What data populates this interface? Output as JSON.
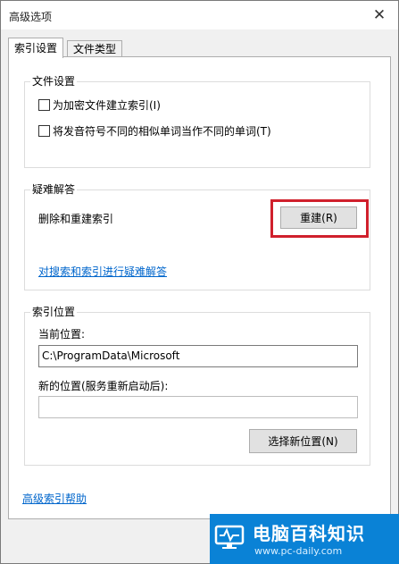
{
  "window": {
    "title": "高级选项",
    "close_glyph": "✕"
  },
  "tabs": [
    {
      "label": "索引设置",
      "active": true
    },
    {
      "label": "文件类型",
      "active": false
    }
  ],
  "file_settings": {
    "label": "文件设置",
    "options": [
      {
        "label": "为加密文件建立索引(I)",
        "checked": false
      },
      {
        "label": "将发音符号不同的相似单词当作不同的单词(T)",
        "checked": false
      }
    ]
  },
  "troubleshooting": {
    "label": "疑难解答",
    "rebuild_text": "删除和重建索引",
    "rebuild_button": "重建(R)",
    "troubleshoot_link": "对搜索和索引进行疑难解答",
    "highlight_color": "#d0202c"
  },
  "index_location": {
    "label": "索引位置",
    "current_label": "当前位置:",
    "current_value": "C:\\ProgramData\\Microsoft",
    "new_label": "新的位置(服务重新启动后):",
    "new_value": "",
    "select_button": "选择新位置(N)"
  },
  "help_link": "高级索引帮助",
  "watermark": {
    "title": "电脑百科知识",
    "url": "www.pc-daily.com",
    "color": "#0a82d6"
  }
}
